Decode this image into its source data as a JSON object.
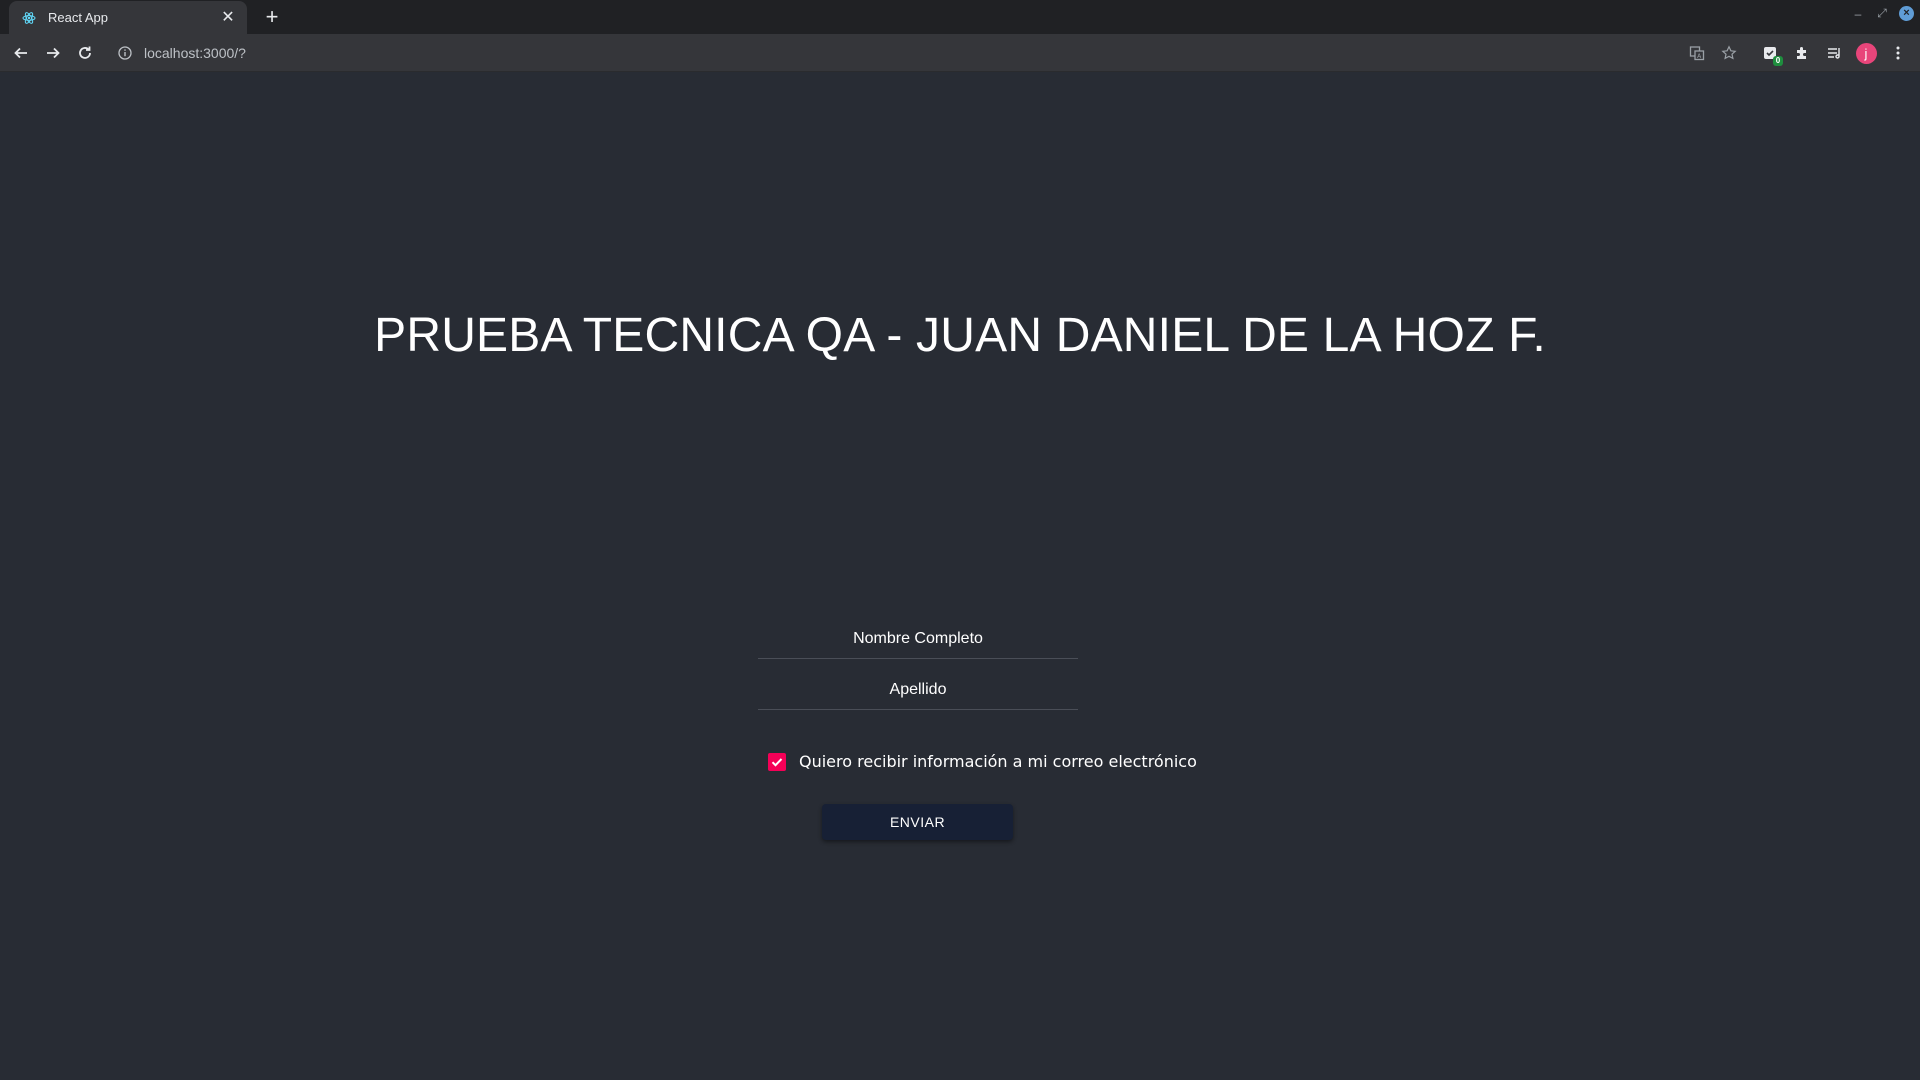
{
  "browser": {
    "tab_title": "React App",
    "url": "localhost:3000/?",
    "extension_badge": "0",
    "profile_initial": "j"
  },
  "page": {
    "title": "PRUEBA TECNICA QA - JUAN DANIEL DE LA HOZ F.",
    "form": {
      "full_name_placeholder": "Nombre Completo",
      "full_name_value": "",
      "last_name_placeholder": "Apellido",
      "last_name_value": "",
      "newsletter_label": "Quiero recibir información a mi correo electrónico",
      "newsletter_checked": true,
      "submit_label": "ENVIAR"
    }
  },
  "colors": {
    "background": "#282c34",
    "checkbox_accent": "#f50057",
    "button_bg": "#172035",
    "avatar": "#e8457a"
  }
}
